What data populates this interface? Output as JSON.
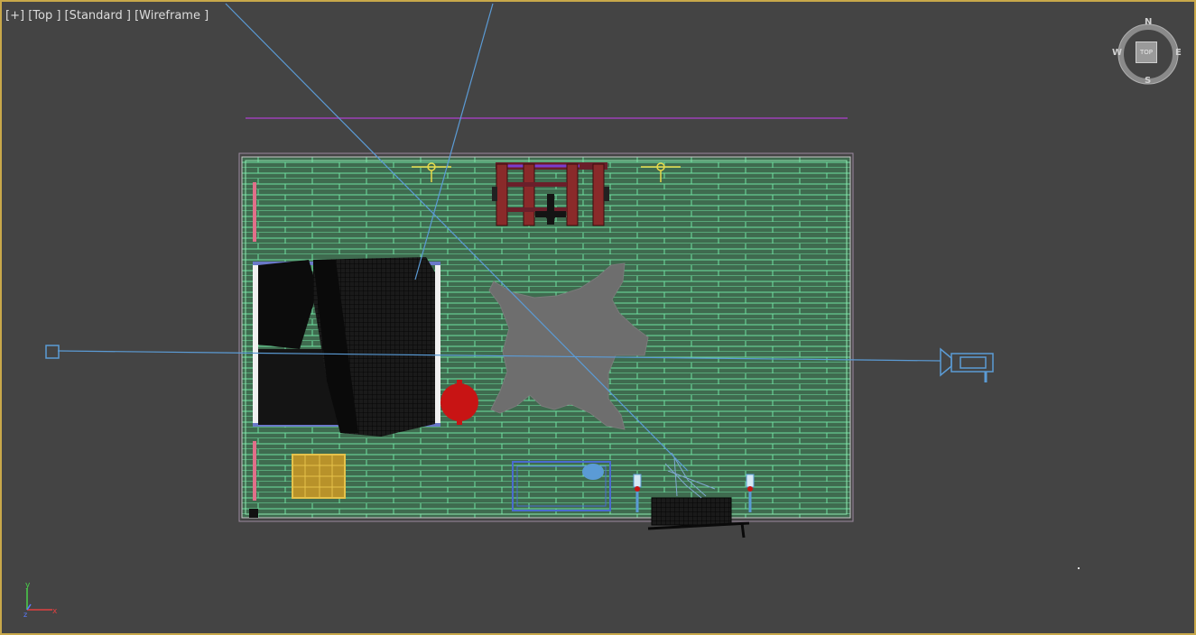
{
  "viewport": {
    "label_plus": "[+]",
    "label_view": "[Top ]",
    "label_shading_mode": "[Standard ]",
    "label_display_mode": "[Wireframe ]"
  },
  "viewcube": {
    "face": "TOP",
    "north": "N",
    "south": "S",
    "east": "E",
    "west": "W"
  },
  "axis_tripod": {
    "y_label": "y",
    "x_label": "x",
    "z_label": "z"
  },
  "colors": {
    "viewport_bg": "#444444",
    "active_border": "#c8a84a",
    "floor": "#3f6b4f",
    "floor_lines": "#6fe0a0",
    "camera": "#5b9bd5",
    "rug": "#6e6e6e",
    "red_object": "#c81414",
    "bookshelf": "#8a2a2a",
    "basket": "#c9a227"
  }
}
